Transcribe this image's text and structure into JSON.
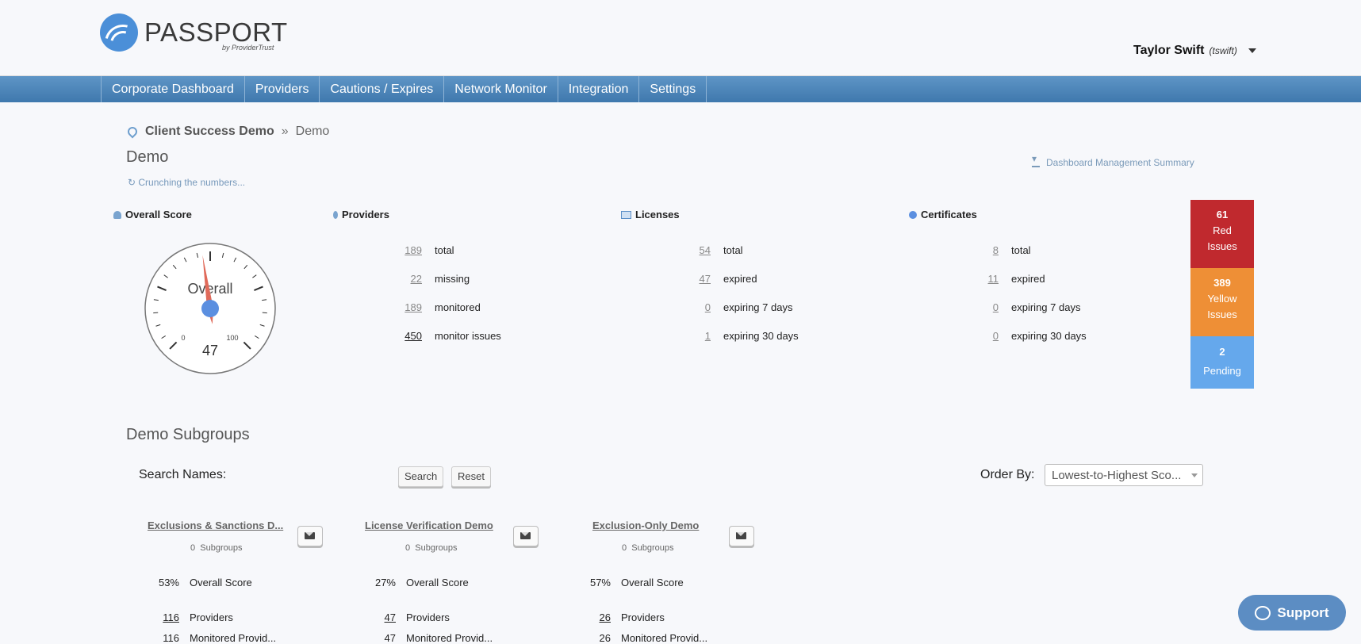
{
  "logo": {
    "text": "PASSPORT",
    "sub": "by ProviderTrust"
  },
  "user": {
    "name": "Taylor Swift",
    "handle": "(tswift)"
  },
  "nav": [
    "Corporate Dashboard",
    "Providers",
    "Cautions / Expires",
    "Network Monitor",
    "Integration",
    "Settings"
  ],
  "breadcrumb": {
    "parent": "Client Success Demo",
    "sep": "»",
    "current": "Demo"
  },
  "page_title": "Demo",
  "status_text": "Crunching the numbers...",
  "download_label": "Dashboard Management Summary",
  "overall": {
    "title": "Overall Score",
    "gauge_label": "Overall",
    "value": "47",
    "score": 47,
    "min_label": "0",
    "max_label": "100"
  },
  "providers": {
    "title": "Providers",
    "rows": [
      {
        "num": "189",
        "label": "total"
      },
      {
        "num": "22",
        "label": "missing"
      },
      {
        "num": "189",
        "label": "monitored"
      },
      {
        "num": "450",
        "label": "monitor issues"
      }
    ]
  },
  "licenses": {
    "title": "Licenses",
    "rows": [
      {
        "num": "54",
        "label": "total"
      },
      {
        "num": "47",
        "label": "expired"
      },
      {
        "num": "0",
        "label": "expiring 7 days"
      },
      {
        "num": "1",
        "label": "expiring 30 days"
      }
    ]
  },
  "certificates": {
    "title": "Certificates",
    "rows": [
      {
        "num": "8",
        "label": "total"
      },
      {
        "num": "11",
        "label": "expired"
      },
      {
        "num": "0",
        "label": "expiring 7 days"
      },
      {
        "num": "0",
        "label": "expiring 30 days"
      }
    ]
  },
  "issues": {
    "red": {
      "count": "61",
      "line1": "Red",
      "line2": "Issues"
    },
    "yellow": {
      "count": "389",
      "line1": "Yellow",
      "line2": "Issues"
    },
    "pending": {
      "count": "2",
      "line1": "Pending"
    }
  },
  "colors": {
    "red": "#c0292e",
    "yellow": "#ee8f36",
    "pending": "#65a8ec",
    "nav": "#4a82b6",
    "needle": "#e06a5a",
    "hub": "#5b8fe0"
  },
  "subgroups": {
    "title": "Demo Subgroups",
    "search_label": "Search Names:",
    "search_button": "Search",
    "reset_button": "Reset",
    "order_label": "Order By:",
    "order_value": "Lowest-to-Highest Sco...",
    "cards": [
      {
        "name": "Exclusions & Sanctions D...",
        "subgroups_count": "0",
        "subgroups_label": "Subgroups",
        "score": "53%",
        "score_label": "Overall Score",
        "providers": "116",
        "providers_label": "Providers",
        "monitored": "116",
        "monitored_label": "Monitored Provid..."
      },
      {
        "name": "License Verification Demo",
        "subgroups_count": "0",
        "subgroups_label": "Subgroups",
        "score": "27%",
        "score_label": "Overall Score",
        "providers": "47",
        "providers_label": "Providers",
        "monitored": "47",
        "monitored_label": "Monitored Provid..."
      },
      {
        "name": "Exclusion-Only Demo",
        "subgroups_count": "0",
        "subgroups_label": "Subgroups",
        "score": "57%",
        "score_label": "Overall Score",
        "providers": "26",
        "providers_label": "Providers",
        "monitored": "26",
        "monitored_label": "Monitored Provid..."
      }
    ]
  },
  "support_label": "Support"
}
